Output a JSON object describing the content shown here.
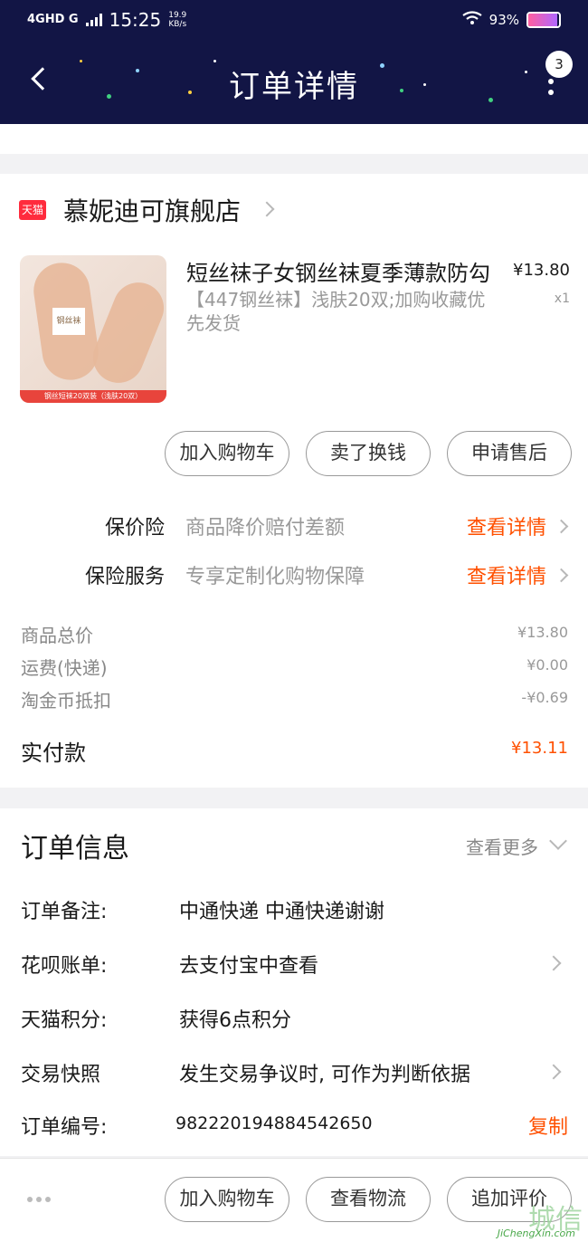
{
  "status_bar": {
    "network": "4GHD G",
    "time": "15:25",
    "speed": "19.9",
    "speed_unit": "KB/s",
    "battery": "93%",
    "battery_level": 0.93
  },
  "header": {
    "title": "订单详情",
    "badge": "3"
  },
  "shop": {
    "badge": "天猫",
    "name": "慕妮迪可旗舰店"
  },
  "product": {
    "title": "短丝袜子女钢丝袜夏季薄款防勾",
    "sku": "【447钢丝袜】浅肤20双;加购收藏优先发货",
    "price": "¥13.80",
    "qty": "x1",
    "image_caption": "钢丝短袜20双装（浅肤20双）",
    "image_label": "钢丝袜"
  },
  "item_actions": [
    "加入购物车",
    "卖了换钱",
    "申请售后"
  ],
  "insurance": [
    {
      "label": "保价险",
      "desc": "商品降价赔付差额",
      "link": "查看详情"
    },
    {
      "label": "保险服务",
      "desc": "专享定制化购物保障",
      "link": "查看详情"
    }
  ],
  "summary": [
    {
      "label": "商品总价",
      "value": "¥13.80"
    },
    {
      "label": "运费(快递)",
      "value": "¥0.00"
    },
    {
      "label": "淘金币抵扣",
      "value": "-¥0.69"
    }
  ],
  "paid": {
    "label": "实付款",
    "value": "¥13.11"
  },
  "order_info": {
    "title": "订单信息",
    "view_more": "查看更多",
    "rows": [
      {
        "label": "订单备注:",
        "value": "中通快递 中通快递谢谢"
      },
      {
        "label": "花呗账单:",
        "value": "去支付宝中查看"
      },
      {
        "label": "天猫积分:",
        "value": "获得6点积分"
      },
      {
        "label": "交易快照",
        "value": "发生交易争议时, 可作为判断依据"
      },
      {
        "label": "订单编号:",
        "value": "982220194884542650"
      }
    ],
    "copy": "复制"
  },
  "footer_actions": [
    "加入购物车",
    "查看物流",
    "追加评价"
  ],
  "watermark": {
    "main": "城信",
    "sub": "JiChengXin.com"
  },
  "colors": {
    "header_bg": "#121545",
    "accent": "#ff5000",
    "tmall_red": "#ff2b3d"
  }
}
